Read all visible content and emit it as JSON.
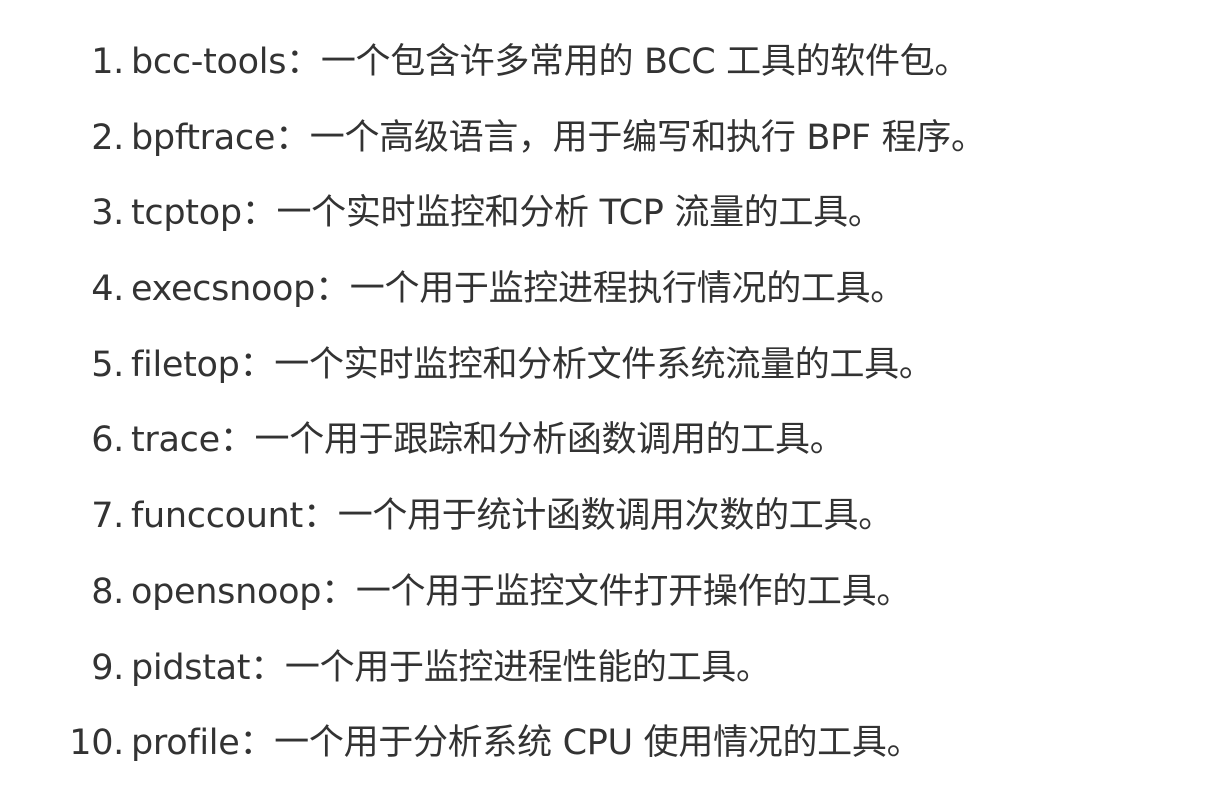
{
  "list": {
    "items": [
      {
        "number": "1.",
        "name": "bcc-tools",
        "separator": "：",
        "description": "一个包含许多常用的 BCC 工具的软件包。"
      },
      {
        "number": "2.",
        "name": "bpftrace",
        "separator": "：",
        "description": "一个高级语言，用于编写和执行 BPF 程序。"
      },
      {
        "number": "3.",
        "name": "tcptop",
        "separator": "：",
        "description": "一个实时监控和分析 TCP 流量的工具。"
      },
      {
        "number": "4.",
        "name": "execsnoop",
        "separator": "：",
        "description": "一个用于监控进程执行情况的工具。"
      },
      {
        "number": "5.",
        "name": "filetop",
        "separator": "：",
        "description": "一个实时监控和分析文件系统流量的工具。"
      },
      {
        "number": "6.",
        "name": "trace",
        "separator": "：",
        "description": "一个用于跟踪和分析函数调用的工具。"
      },
      {
        "number": "7.",
        "name": "funccount",
        "separator": "：",
        "description": "一个用于统计函数调用次数的工具。"
      },
      {
        "number": "8.",
        "name": "opensnoop",
        "separator": "：",
        "description": "一个用于监控文件打开操作的工具。"
      },
      {
        "number": "9.",
        "name": "pidstat",
        "separator": "：",
        "description": "一个用于监控进程性能的工具。"
      },
      {
        "number": "10.",
        "name": "profile",
        "separator": "：",
        "description": "一个用于分析系统 CPU 使用情况的工具。"
      }
    ]
  }
}
